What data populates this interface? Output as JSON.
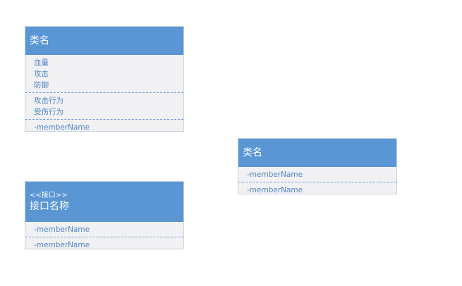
{
  "diagram": {
    "boxes": [
      {
        "title": "类名",
        "sections": [
          [
            "血量",
            "攻击",
            "防御"
          ],
          [
            "攻击行为",
            "受伤行为"
          ],
          [
            "-memberName"
          ]
        ]
      },
      {
        "title": "类名",
        "sections": [
          [
            "-memberName"
          ],
          [
            "-memberName"
          ]
        ]
      },
      {
        "stereotype": "<<接口>>",
        "title": "接口名称",
        "sections": [
          [
            "-memberName"
          ],
          [
            "-memberName"
          ]
        ]
      }
    ]
  }
}
